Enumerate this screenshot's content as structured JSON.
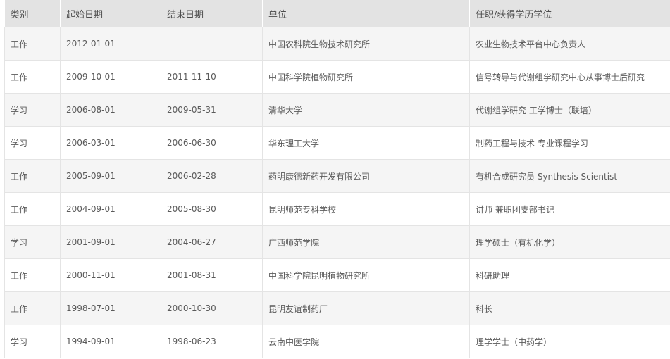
{
  "table": {
    "headers": [
      "类别",
      "起始日期",
      "结束日期",
      "单位",
      "任职/获得学历学位"
    ],
    "rows": [
      [
        "工作",
        "2012-01-01",
        "",
        "中国农科院生物技术研究所",
        "农业生物技术平台中心负责人"
      ],
      [
        "工作",
        "2009-10-01",
        "2011-11-10",
        "中国科学院植物研究所",
        "信号转导与代谢组学研究中心从事博士后研究"
      ],
      [
        "学习",
        "2006-08-01",
        "2009-05-31",
        "清华大学",
        "代谢组学研究 工学博士（联培）"
      ],
      [
        "学习",
        "2006-03-01",
        "2006-06-30",
        "华东理工大学",
        "制药工程与技术 专业课程学习"
      ],
      [
        "工作",
        "2005-09-01",
        "2006-02-28",
        "药明康德新药开发有限公司",
        "有机合成研究员 Synthesis Scientist"
      ],
      [
        "工作",
        "2004-09-01",
        "2005-08-30",
        "昆明师范专科学校",
        "讲师 兼职团支部书记"
      ],
      [
        "学习",
        "2001-09-01",
        "2004-06-27",
        "广西师范学院",
        "理学硕士（有机化学）"
      ],
      [
        "工作",
        "2000-11-01",
        "2001-08-31",
        "中国科学院昆明植物研究所",
        "科研助理"
      ],
      [
        "工作",
        "1998-07-01",
        "2000-10-30",
        "昆明友谊制药厂",
        "科长"
      ],
      [
        "学习",
        "1994-09-01",
        "1998-06-23",
        "云南中医学院",
        "理学学士（中药学）"
      ]
    ]
  }
}
